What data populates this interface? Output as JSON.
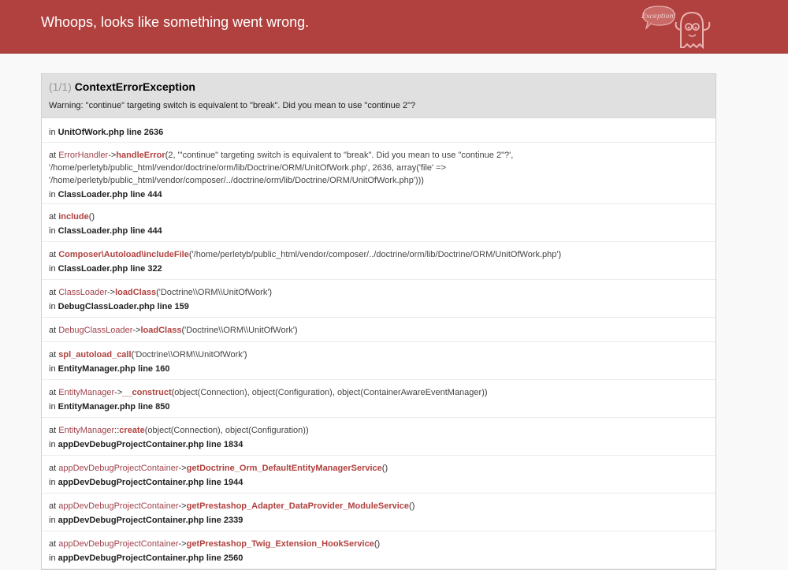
{
  "header": {
    "title": "Whoops, looks like something went wrong.",
    "badge_text": "Exception!"
  },
  "exception": {
    "count": "(1/1)",
    "name": "ContextErrorException",
    "message": "Warning: \"continue\" targeting switch is equivalent to \"break\". Did you mean to use \"continue 2\"?"
  },
  "colors": {
    "header_bg": "#b0413e",
    "function": "#b0413e",
    "class": "#a0424b"
  },
  "trace": [
    {
      "location": "UnitOfWork.php line 2636"
    },
    {
      "class": "ErrorHandler",
      "sep": "->",
      "func": "handleError",
      "args": "2, '\"continue\" targeting switch is equivalent to \"break\". Did you mean to use \"continue 2\"?', '/home/perletyb/public_html/vendor/doctrine/orm/lib/Doctrine/ORM/UnitOfWork.php', 2636, array('file' => '/home/perletyb/public_html/vendor/composer/../doctrine/orm/lib/Doctrine/ORM/UnitOfWork.php'))",
      "location": "ClassLoader.php line 444"
    },
    {
      "class": "",
      "sep": "",
      "func": "include",
      "args": "",
      "location": "ClassLoader.php line 444"
    },
    {
      "class": "",
      "sep": "",
      "func": "Composer\\Autoload\\includeFile",
      "args": "'/home/perletyb/public_html/vendor/composer/../doctrine/orm/lib/Doctrine/ORM/UnitOfWork.php'",
      "location": "ClassLoader.php line 322"
    },
    {
      "class": "ClassLoader",
      "sep": "->",
      "func": "loadClass",
      "args": "'Doctrine\\\\ORM\\\\UnitOfWork'",
      "location": "DebugClassLoader.php line 159"
    },
    {
      "class": "DebugClassLoader",
      "sep": "->",
      "func": "loadClass",
      "args": "'Doctrine\\\\ORM\\\\UnitOfWork'",
      "location": ""
    },
    {
      "class": "",
      "sep": "",
      "func": "spl_autoload_call",
      "args": "'Doctrine\\\\ORM\\\\UnitOfWork'",
      "location": "EntityManager.php line 160"
    },
    {
      "class": "EntityManager",
      "sep": "->",
      "func": "__construct",
      "args": "object(Connection), object(Configuration), object(ContainerAwareEventManager)",
      "location": "EntityManager.php line 850"
    },
    {
      "class": "EntityManager",
      "sep": "::",
      "func": "create",
      "args": "object(Connection), object(Configuration)",
      "location": "appDevDebugProjectContainer.php line 1834"
    },
    {
      "class": "appDevDebugProjectContainer",
      "sep": "->",
      "func": "getDoctrine_Orm_DefaultEntityManagerService",
      "args": "",
      "location": "appDevDebugProjectContainer.php line 1944"
    },
    {
      "class": "appDevDebugProjectContainer",
      "sep": "->",
      "func": "getPrestashop_Adapter_DataProvider_ModuleService",
      "args": "",
      "location": "appDevDebugProjectContainer.php line 2339"
    },
    {
      "class": "appDevDebugProjectContainer",
      "sep": "->",
      "func": "getPrestashop_Twig_Extension_HookService",
      "args": "",
      "location": "appDevDebugProjectContainer.php line 2560"
    }
  ]
}
